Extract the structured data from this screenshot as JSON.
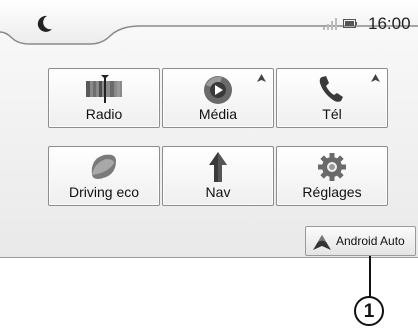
{
  "status_bar": {
    "night_mode_icon": "moon-icon",
    "signal_icon": "signal-icon",
    "battery_icon": "battery-icon",
    "time": "16:00"
  },
  "menu": {
    "tiles": [
      {
        "label": "Radio",
        "icon": "radio-icon",
        "android_auto_badge": false
      },
      {
        "label": "Média",
        "icon": "media-play-icon",
        "android_auto_badge": true
      },
      {
        "label": "Tél",
        "icon": "phone-icon",
        "android_auto_badge": true
      },
      {
        "label": "Driving eco",
        "icon": "eco-leaf-icon",
        "android_auto_badge": false
      },
      {
        "label": "Nav",
        "icon": "navigation-arrow-icon",
        "android_auto_badge": false
      },
      {
        "label": "Réglages",
        "icon": "settings-gear-icon",
        "android_auto_badge": false
      }
    ]
  },
  "android_auto_button": {
    "label": "Android Auto",
    "icon": "android-auto-logo"
  },
  "callout": {
    "number": "1"
  }
}
